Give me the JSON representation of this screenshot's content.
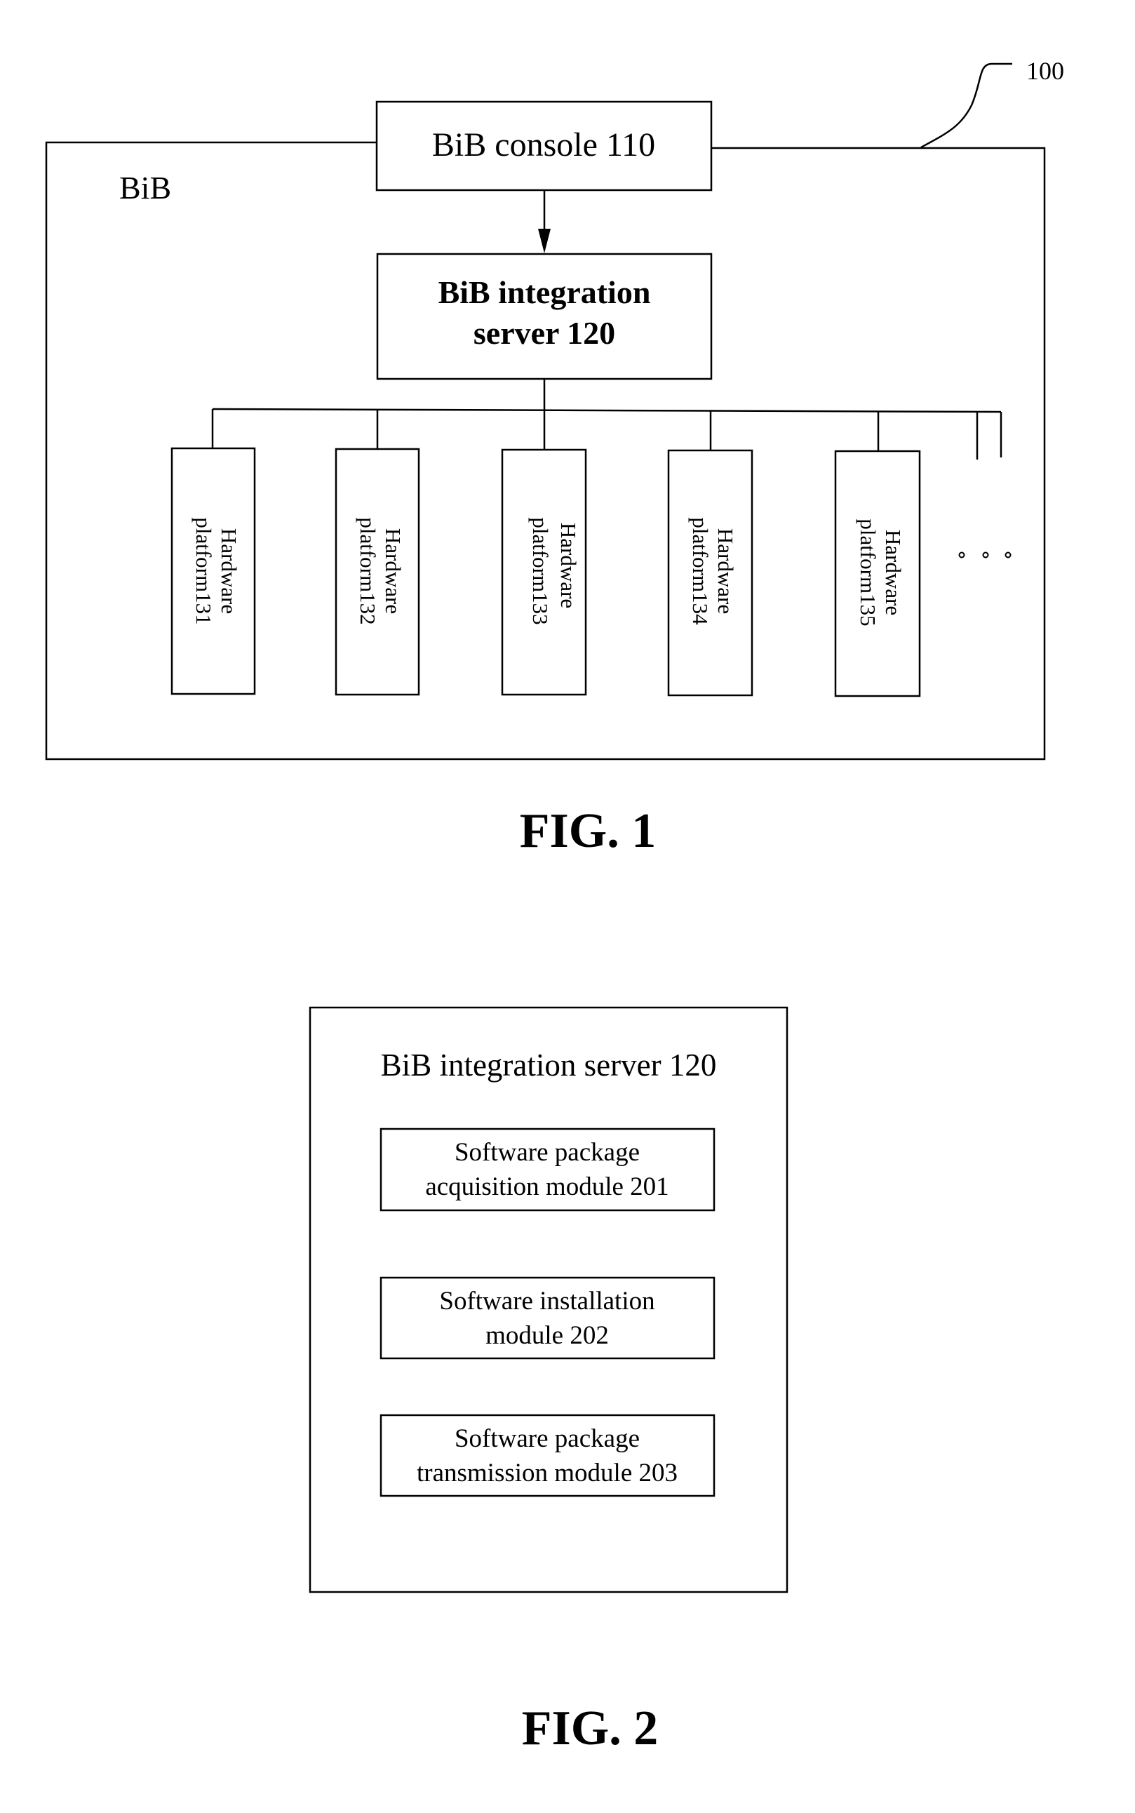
{
  "fig1": {
    "reference_label": "100",
    "container_label": "BiB",
    "console": {
      "label": "BiB console 110"
    },
    "integration_server": {
      "lines": [
        "BiB integration",
        "server 120"
      ]
    },
    "hardware_platforms": [
      {
        "lines": [
          "Hardware",
          "platform131"
        ]
      },
      {
        "lines": [
          "Hardware",
          "platform132"
        ]
      },
      {
        "lines": [
          "Hardware",
          "platform133"
        ]
      },
      {
        "lines": [
          "Hardware",
          "platform134"
        ]
      },
      {
        "lines": [
          "Hardware",
          "platform135"
        ]
      }
    ],
    "ellipsis": "∘ ∘ ∘",
    "caption": "FIG. 1"
  },
  "fig2": {
    "title": "BiB integration server 120",
    "modules": [
      {
        "lines": [
          "Software package",
          "acquisition module 201"
        ]
      },
      {
        "lines": [
          "Software installation",
          "module 202"
        ]
      },
      {
        "lines": [
          "Software package",
          "transmission module 203"
        ]
      }
    ],
    "caption": "FIG. 2"
  }
}
